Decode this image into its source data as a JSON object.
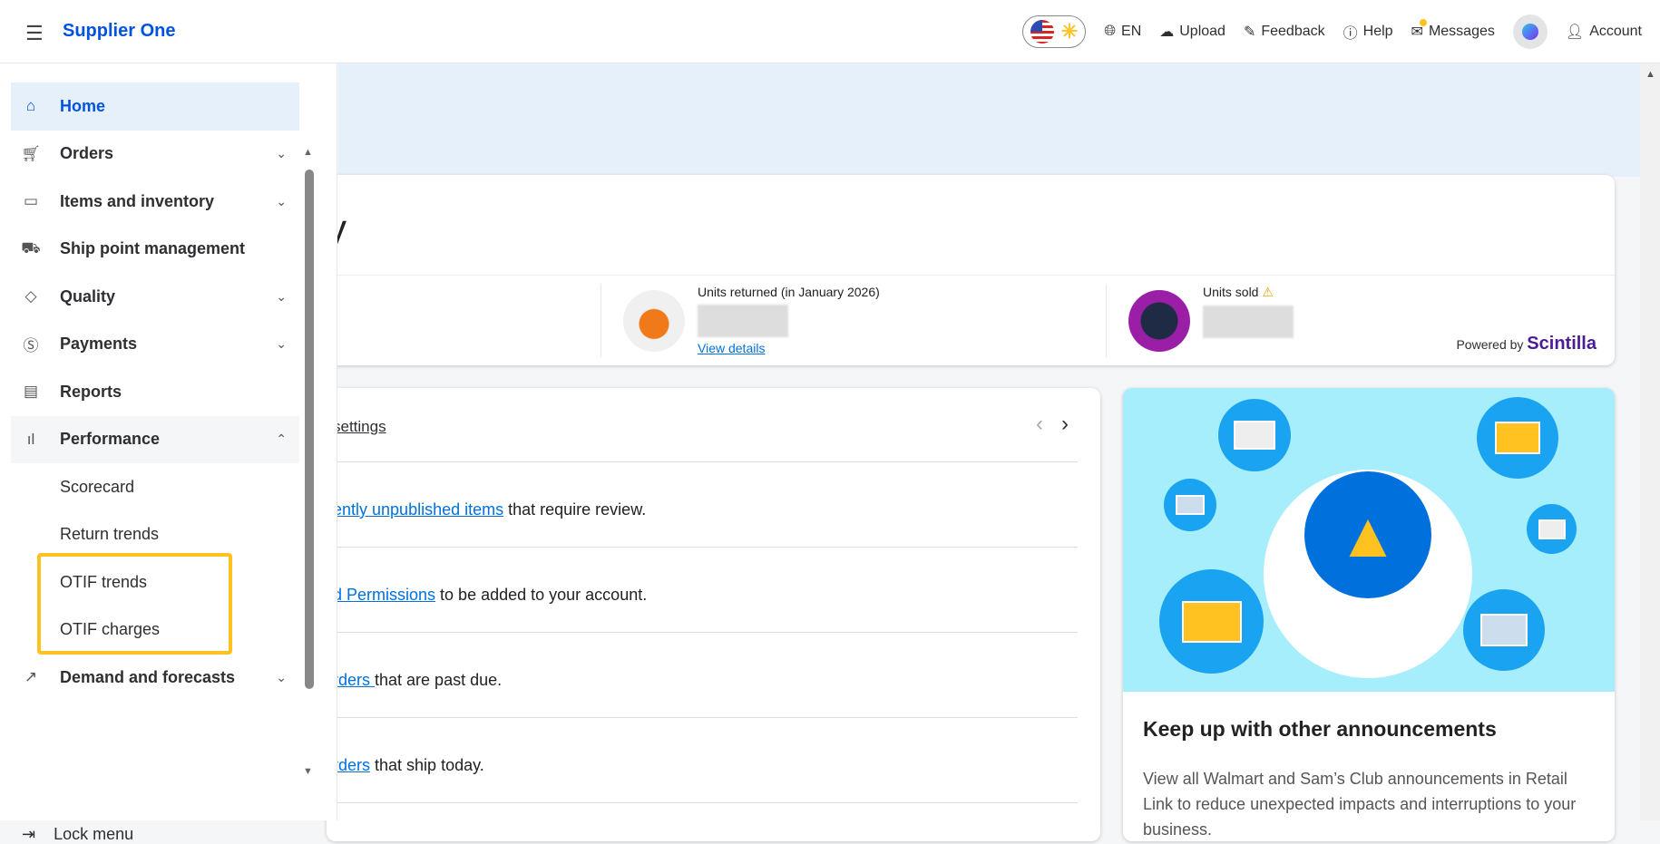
{
  "header": {
    "brand": "Supplier One",
    "language": "EN",
    "upload": "Upload",
    "feedback": "Feedback",
    "help": "Help",
    "messages": "Messages",
    "account": "Account"
  },
  "sidebar": {
    "items": [
      {
        "label": "Home",
        "icon": "home-icon"
      },
      {
        "label": "Orders",
        "icon": "cart-icon"
      },
      {
        "label": "Items and inventory",
        "icon": "box-icon"
      },
      {
        "label": "Ship point management",
        "icon": "truck-icon"
      },
      {
        "label": "Quality",
        "icon": "diamond-icon"
      },
      {
        "label": "Payments",
        "icon": "dollar-icon"
      },
      {
        "label": "Reports",
        "icon": "clipboard-icon"
      },
      {
        "label": "Performance",
        "icon": "bar-chart-icon"
      },
      {
        "label": "Demand and forecasts",
        "icon": "trend-icon"
      }
    ],
    "performance_sub": [
      "Scorecard",
      "Return trends",
      "OTIF trends",
      "OTIF charges"
    ],
    "lock": "Lock menu"
  },
  "summary": {
    "title_fragment": "y",
    "returned_label": "Units returned (in January 2026)",
    "view_details": "View details",
    "sold_label": "Units sold",
    "powered_by": "Powered by",
    "powered_brand": "Scintilla"
  },
  "tasks": {
    "settings_link": "settings",
    "items": [
      {
        "link": "ently unpublished items",
        "text": " that require review."
      },
      {
        "link": "d Permissions",
        "text": " to be added to your account."
      },
      {
        "link": "rders ",
        "text": "that are past due."
      },
      {
        "link": "rders",
        "text": " that ship today."
      }
    ]
  },
  "announcement": {
    "title": "Keep up with other announcements",
    "body": "View all Walmart and Sam’s Club announcements in Retail Link to reduce unexpected impacts and interruptions to your business."
  }
}
